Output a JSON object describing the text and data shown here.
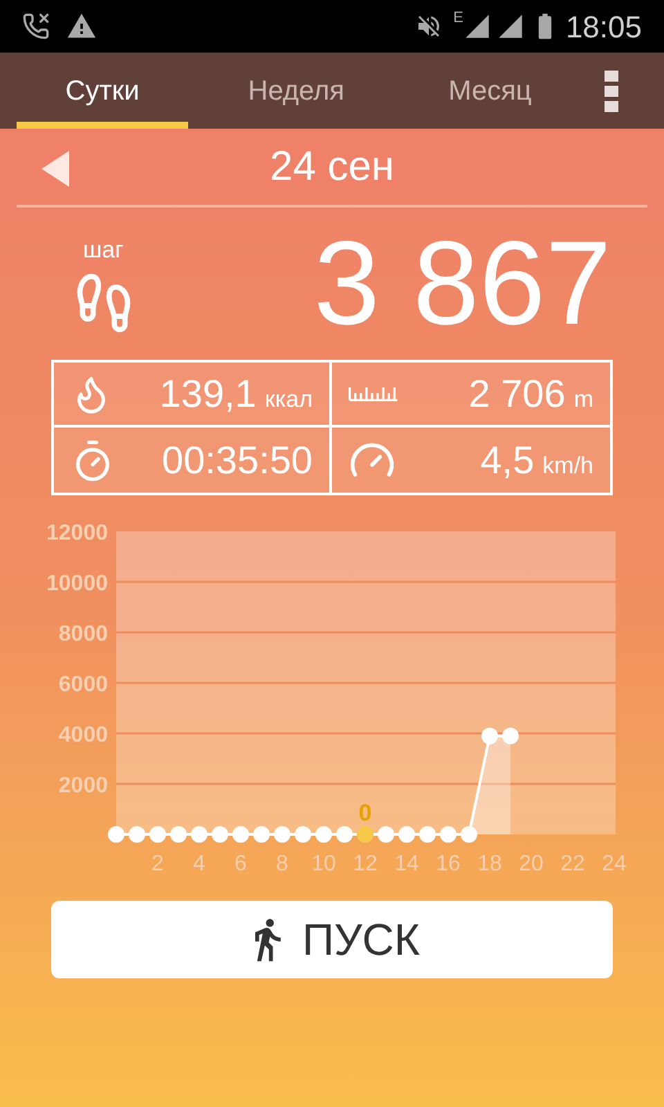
{
  "status_bar": {
    "network_label": "E",
    "time": "18:05"
  },
  "tabs": [
    {
      "label": "Сутки",
      "selected": true
    },
    {
      "label": "Неделя",
      "selected": false
    },
    {
      "label": "Месяц",
      "selected": false
    }
  ],
  "date": "24 сен",
  "steps": {
    "unit": "шаг",
    "value": "3 867"
  },
  "stats": [
    {
      "kind": "calories",
      "value": "139,1",
      "unit": "ккал"
    },
    {
      "kind": "distance",
      "value": "2 706",
      "unit": "m"
    },
    {
      "kind": "time",
      "value": "00:35:50"
    },
    {
      "kind": "speed",
      "value": "4,5",
      "unit": "km/h"
    }
  ],
  "chart": {
    "chart_data": {
      "type": "area",
      "x": [
        0,
        1,
        2,
        3,
        4,
        5,
        6,
        7,
        8,
        9,
        10,
        11,
        12,
        13,
        14,
        15,
        16,
        17,
        18,
        19
      ],
      "values": [
        0,
        0,
        0,
        0,
        0,
        0,
        0,
        0,
        0,
        0,
        0,
        0,
        0,
        0,
        0,
        0,
        0,
        0,
        3900,
        3900
      ],
      "grid": true,
      "xlim": [
        0,
        24
      ],
      "ylim": [
        0,
        12000
      ],
      "xticks": [
        2,
        4,
        6,
        8,
        10,
        12,
        14,
        16,
        18,
        20,
        22,
        24
      ],
      "yticks": [
        2000,
        4000,
        6000,
        8000,
        10000,
        12000
      ],
      "annotations": [
        {
          "x": 12,
          "y": 0,
          "text": "0"
        }
      ]
    }
  },
  "start_button": {
    "label": "ПУСК"
  }
}
